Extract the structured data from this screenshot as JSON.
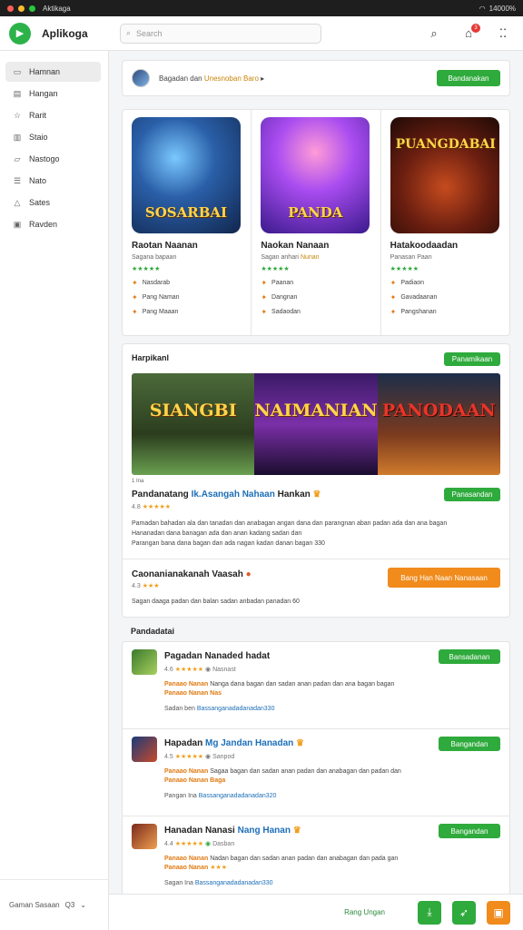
{
  "titlebar": {
    "title": "Aktikaga",
    "status": "14000%"
  },
  "header": {
    "app_name": "Aplikoga",
    "search_placeholder": "Search",
    "notif_count": "3"
  },
  "sidebar": {
    "items": [
      {
        "label": "Hamnan",
        "icon": "home-icon"
      },
      {
        "label": "Hangan",
        "icon": "grid-icon"
      },
      {
        "label": "Rarit",
        "icon": "star-icon"
      },
      {
        "label": "Staio",
        "icon": "chart-icon"
      },
      {
        "label": "Nastogo",
        "icon": "tag-icon"
      },
      {
        "label": "Nato",
        "icon": "list-icon"
      },
      {
        "label": "Sates",
        "icon": "triangle-icon"
      },
      {
        "label": "Ravden",
        "icon": "box-icon"
      }
    ],
    "footer_label": "Gaman Sasaan",
    "footer_value": "Q3"
  },
  "welcome": {
    "text": "Bagadan dan",
    "highlight": "Unesnoban Baro",
    "button": "Bandanakan"
  },
  "featured": [
    {
      "overlay": "SOSARBAI",
      "title": "Raotan Naanan",
      "sub": "Sagana bapaan",
      "sub_hl": "",
      "stars": "★★★★★",
      "meta1": "Nasdarab",
      "meta2": "Pang Naman",
      "meta3": "Pang Maaan"
    },
    {
      "overlay": "PANDA",
      "title": "Naokan Nanaan",
      "sub": "Sagan anhari",
      "sub_hl": "Nunan",
      "stars": "★★★★★",
      "meta1": "Paanan",
      "meta2": "Dangnan",
      "meta3": "Sadaodan"
    },
    {
      "overlay": "PUANGDABAI",
      "title": "Hatakoodaadan",
      "sub": "Panasan Paan",
      "sub_hl": "",
      "stars": "★★★★★",
      "meta1": "Padiaon",
      "meta2": "Gavadaanan",
      "meta3": "Pangshanan"
    }
  ],
  "spotlight": {
    "heading": "Harpikanl",
    "top_button": "Panamikaan",
    "banner": [
      "SIANGBI",
      "NAIMANIAN",
      "PANODAAN"
    ],
    "tag": "1 Ina",
    "title": "Pandanatang",
    "title_hl": "Ik.Asangah Nahaan",
    "title_tail": "Hankan",
    "rating_prefix": "4.8",
    "rating_stars": "★★★★★",
    "install_button": "Panasandan",
    "desc_line1": "Pamadan bahadan ala dan tanadan dan anabagan angan dana dan parangnan aban padan ada dan ana bagan",
    "desc_line2": "Hananadan dana banagan ada dan anan kadang sadan dan",
    "desc_line3": "Parangan bana dana bagan dan ada nagan kadan danan bagan 330",
    "promo_title": "Caonanianakanah",
    "promo_hl": "Vaasah",
    "promo_rating_prefix": "4.3",
    "promo_stars": "★★★",
    "promo_button": "Bang Han Naan Nanasaan",
    "promo_desc": "Sagan daaga padan dan balan sadan anbadan panadan 60"
  },
  "recommended": {
    "heading": "Pandadatai",
    "items": [
      {
        "title": "Pagadan Nanaded",
        "title_hl": "",
        "title_tail": "hadat",
        "rating_prefix": "4.6",
        "stars": "★★★★★",
        "badge": "Nasnast",
        "button": "Bansadanan",
        "desc_orange": "Panaao Nanan",
        "desc": "Nanga dana bagan dan sadan anan padan dan ana bagan bagan",
        "desc2": "Panaao Nanan Nas",
        "link_label": "Sadan ben",
        "link": "Bassanganadadanadan330"
      },
      {
        "title": "Hapadan",
        "title_hl": "Mg Jandan",
        "title_tail": "Hanadan",
        "rating_prefix": "4.5",
        "stars": "★★★★★",
        "badge": "Sanpod",
        "button": "Bangandan",
        "desc_orange": "Panaao Nanan",
        "desc": "Sagaa bagan dan sadan anan padan dan anabagan dan padan dan",
        "desc2": "Panaao Nanan Baga",
        "link_label": "Pangan Ina",
        "link": "Bassanganadadanadan320"
      },
      {
        "title": "Hanadan Nanasi",
        "title_hl": "Nang Hanan",
        "title_tail": "",
        "rating_prefix": "4.4",
        "stars": "★★★★★",
        "badge": "Dasban",
        "button": "Bangandan",
        "desc_orange": "Panaao Nanan",
        "desc": "Nadan bagan dan sadan anan padan dan anabagan dan pada gan",
        "desc2": "Panaao Nanan",
        "link_label": "Sagan Ina",
        "link": "Bassanganadadanadan330"
      }
    ]
  },
  "bottom": {
    "link": "Rang Ungan"
  },
  "colors": {
    "accent_green": "#2faa3c",
    "accent_orange": "#f08b1c",
    "link_blue": "#1d6fb8"
  }
}
